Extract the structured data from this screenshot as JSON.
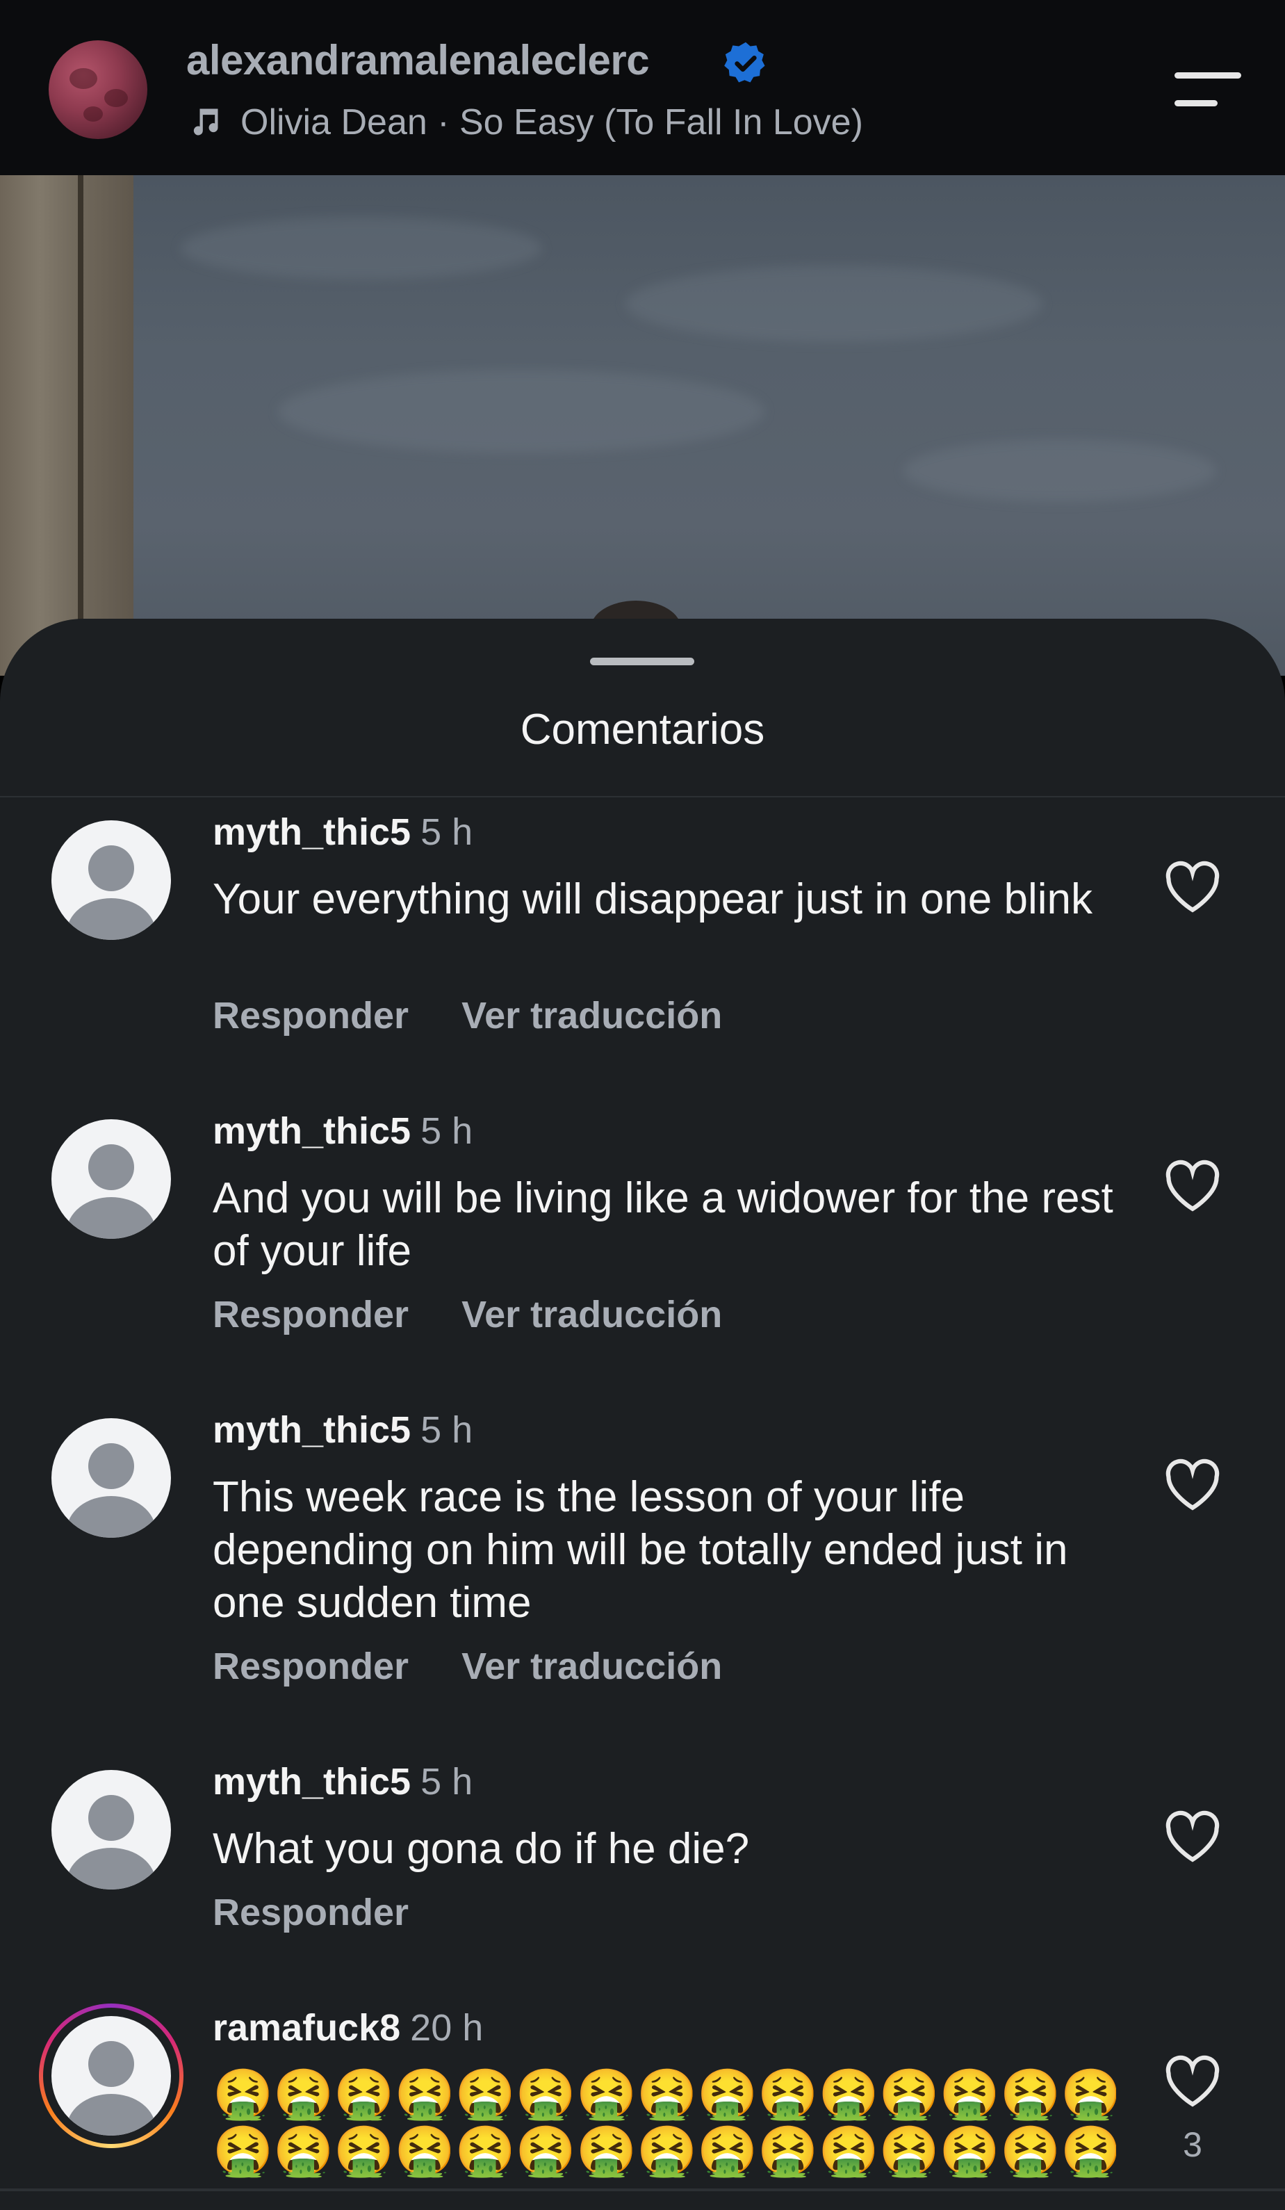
{
  "header": {
    "username": "alexandramalenaleclerc",
    "song": "Olivia Dean · So Easy (To Fall In Love)",
    "verified_icon": "verified-badge-icon",
    "music_icon": "music-note-icon",
    "menu_icon": "menu-icon"
  },
  "sheet": {
    "title": "Comentarios"
  },
  "comments": [
    {
      "user": "myth_thic5",
      "time": "5 h",
      "text": "Your everything will disappear just in one blink",
      "reply": "Responder",
      "translate": "Ver traducción"
    },
    {
      "user": "myth_thic5",
      "time": "5 h",
      "text": "And you will be living like a widower for the rest of your life",
      "reply": "Responder",
      "translate": "Ver traducción"
    },
    {
      "user": "myth_thic5",
      "time": "5 h",
      "text": "This week race is the lesson of your life depending on him will be totally ended just in one sudden time",
      "reply": "Responder",
      "translate": "Ver traducción"
    },
    {
      "user": "myth_thic5",
      "time": "5 h",
      "text": "What you gona do if he die?",
      "reply": "Responder"
    },
    {
      "user": "ramafuck8",
      "time": "20 h",
      "emoji_line_1": "🤮🤮🤮🤮🤮🤮🤮🤮🤮🤮🤮🤮🤮🤮🤮",
      "emoji_line_2": "🤮🤮🤮🤮🤮🤮🤮🤮🤮🤮🤮🤮🤮🤮🤮",
      "likes": "3"
    }
  ],
  "colors": {
    "background": "#1c1f22",
    "header": "#0b0c0e",
    "text_primary": "#f4f4f4",
    "text_secondary": "#a8adb5",
    "verified": "#1d6fd6"
  }
}
